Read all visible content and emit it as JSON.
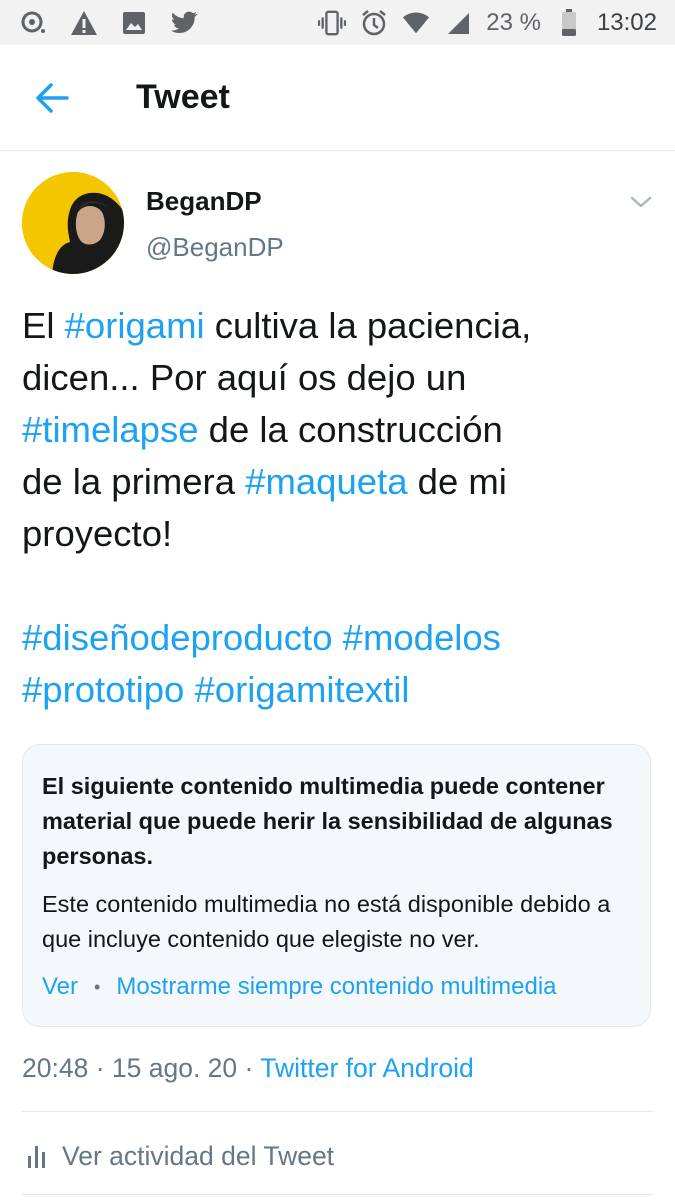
{
  "status_bar": {
    "battery": "23 %",
    "time": "13:02",
    "left_icons": [
      "notification-icon",
      "warning-icon",
      "image-icon",
      "twitter-icon"
    ],
    "right_icons": [
      "vibrate-icon",
      "alarm-icon",
      "wifi-icon",
      "signal-icon",
      "battery-icon"
    ]
  },
  "header": {
    "title": "Tweet"
  },
  "tweet": {
    "author_name": "BeganDP",
    "author_handle": "@BeganDP",
    "text_segments": [
      {
        "text": "El ",
        "tag": false
      },
      {
        "text": "#origami",
        "tag": true
      },
      {
        "text": " cultiva la paciencia,\ndicen... Por aquí os dejo un\n",
        "tag": false
      },
      {
        "text": "#timelapse",
        "tag": true
      },
      {
        "text": " de la construcción\nde la primera ",
        "tag": false
      },
      {
        "text": "#maqueta",
        "tag": true
      },
      {
        "text": " de mi\nproyecto!\n\n",
        "tag": false
      },
      {
        "text": "#diseñodeproducto",
        "tag": true
      },
      {
        "text": " ",
        "tag": false
      },
      {
        "text": "#modelos",
        "tag": true
      },
      {
        "text": "\n",
        "tag": false
      },
      {
        "text": "#prototipo",
        "tag": true
      },
      {
        "text": " ",
        "tag": false
      },
      {
        "text": "#origamitextil",
        "tag": true
      }
    ],
    "sensitive_notice": {
      "title": "El siguiente contenido multimedia puede contener material que puede herir la sensibilidad de algunas personas.",
      "body": "Este contenido multimedia no está disponible debido a que incluye contenido que elegiste no ver.",
      "view_label": "Ver",
      "separator": "•",
      "always_show_label": "Mostrarme siempre contenido multimedia"
    },
    "time": "20:48",
    "date": "15 ago. 20",
    "meta_separator": " · ",
    "source": "Twitter for Android",
    "activity_label": "Ver actividad del Tweet"
  },
  "colors": {
    "accent": "#1da1f2",
    "secondary_text": "#657786",
    "avatar_bg": "#f3c600"
  }
}
